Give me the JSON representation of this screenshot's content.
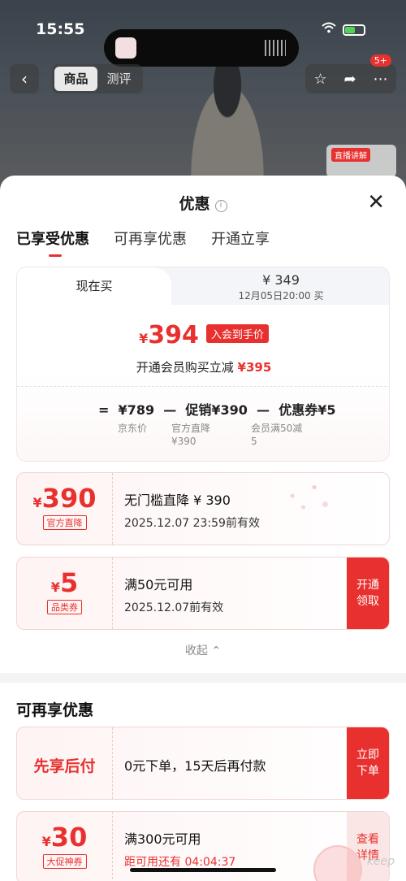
{
  "status_bar": {
    "time": "15:55",
    "wifi_icon": "wifi-icon",
    "battery_icon": "battery-charging-icon"
  },
  "top_nav": {
    "back_icon": "chevron-left-icon",
    "segments": [
      "商品",
      "测评"
    ],
    "active_segment": "商品",
    "icons": [
      "star-icon",
      "share-icon",
      "more-icon"
    ],
    "more_badge": "5+",
    "live_label": "直播讲解"
  },
  "sheet": {
    "title": "优惠",
    "tabs": [
      "已享受优惠",
      "可再享优惠",
      "开通立享"
    ],
    "active_tab": "已享受优惠",
    "compare": {
      "tab_now": "现在买",
      "tab_later_price": "¥ 349",
      "tab_later_date": "12月05日20:00 买",
      "final_yen": "¥",
      "final_price": "394",
      "final_tag": "入会到手价",
      "member_text": "开通会员购买立减",
      "member_amount": "¥395",
      "formula": {
        "eq": "=",
        "p1": "¥789",
        "op1": "—",
        "p2": "促销¥390",
        "op2": "—",
        "p3": "优惠券¥5",
        "l1": "京东价",
        "l2a": "官方直降",
        "l2b": "¥390",
        "l3a": "会员满50减",
        "l3b": "5"
      }
    },
    "coupons": [
      {
        "yen": "¥",
        "amount": "390",
        "kind": "官方直降",
        "line1": "无门槛直降 ¥ 390",
        "line2": "2025.12.07 23:59前有效"
      },
      {
        "yen": "¥",
        "amount": "5",
        "kind": "品类券",
        "line1": "满50元可用",
        "line2": "2025.12.07前有效",
        "action": "开通领取"
      }
    ],
    "collapse_label": "收起 ⌃",
    "more_section": {
      "title": "可再享优惠",
      "pay_later": {
        "label": "先享后付",
        "text": "0元下单，15天后再付款",
        "action": "立即下单"
      },
      "big_promo": {
        "yen": "¥",
        "amount": "30",
        "kind": "大促神券",
        "line1": "满300元可用",
        "line2": "距可用还有 04:04:37",
        "action": "查看详情"
      }
    },
    "watermark": "keep"
  },
  "colors": {
    "accent": "#e8312f",
    "accent_pale": "#fbe6e6"
  }
}
